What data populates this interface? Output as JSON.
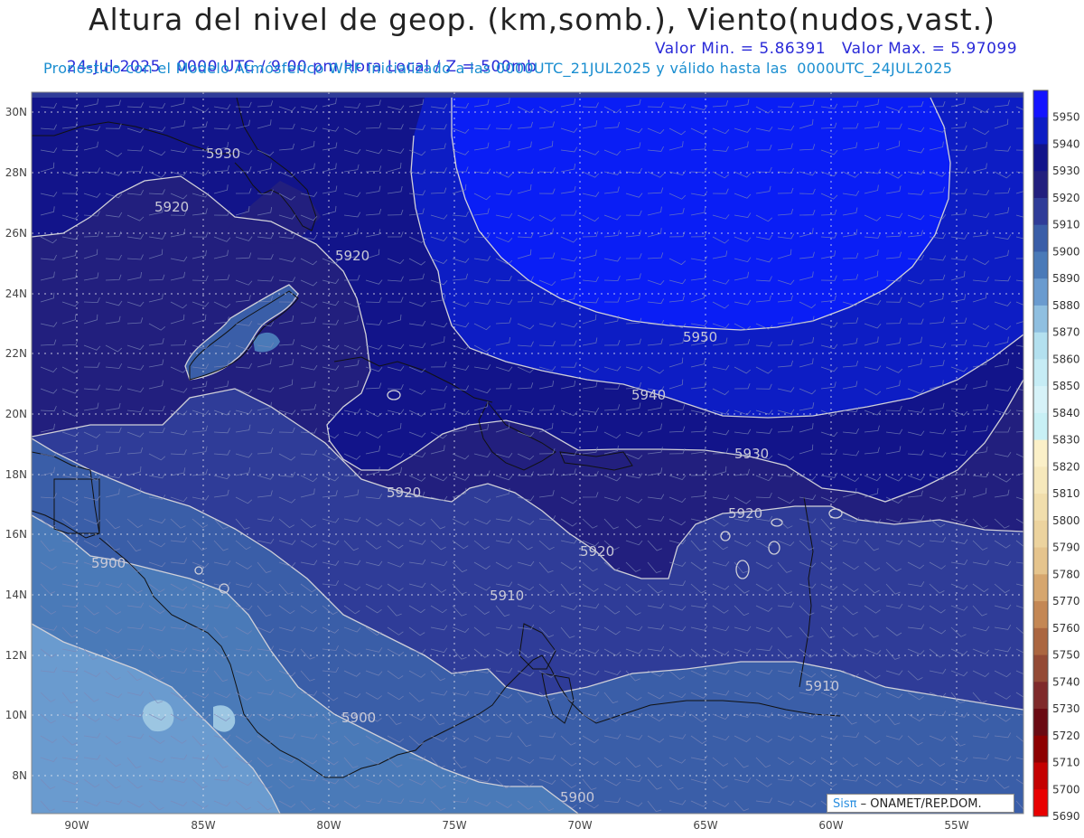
{
  "header": {
    "title": "Altura del nivel de geop. (km,somb.), Viento(nudos,vast.)",
    "subtitle_left": "24-Jul-2025   0000 UTC / 9:00 pm Hora Local / Z = 500mb",
    "subtitle_right": "Valor Min. = 5.86391   Valor Max. = 5.97099",
    "subtitle2": "Pronóstico con el Modelo Atmósferico WRF inicializado a las 0000UTC_21JUL2025 y válido hasta las  0000UTC_24JUL2025"
  },
  "map": {
    "lat_labels": [
      "30N",
      "28N",
      "26N",
      "24N",
      "22N",
      "20N",
      "18N",
      "16N",
      "14N",
      "12N",
      "10N",
      "8N"
    ],
    "lon_labels": [
      "90W",
      "85W",
      "80W",
      "75W",
      "70W",
      "65W",
      "60W",
      "55W"
    ],
    "contour_labels": [
      "5930",
      "5920",
      "5920",
      "5950",
      "5940",
      "5930",
      "5920",
      "5920",
      "5920",
      "5910",
      "5900",
      "5910",
      "5900",
      "5900"
    ],
    "colors": {
      "5950": "#0a1ef5",
      "5940": "#0d1dc4",
      "5930": "#12148a",
      "5920": "#221f7e",
      "5910": "#2f3c98",
      "5900": "#3a5ea8",
      "5890": "#4a7ab8",
      "5880": "#6a9bcf",
      "5870": "#9cc6e2",
      "contour_line": "#d0d0d8",
      "coast": "#111111"
    }
  },
  "colorbar": {
    "labels": [
      "5950",
      "5940",
      "5930",
      "5920",
      "5910",
      "5900",
      "5890",
      "5880",
      "5870",
      "5860",
      "5850",
      "5840",
      "5830",
      "5820",
      "5810",
      "5800",
      "5790",
      "5780",
      "5770",
      "5760",
      "5750",
      "5740",
      "5730",
      "5720",
      "5710",
      "5700",
      "5690"
    ],
    "colors": [
      "#1414ff",
      "#0d1dc4",
      "#12148a",
      "#221f7e",
      "#2f3c98",
      "#3a5ea8",
      "#4a7ab8",
      "#6a9bcf",
      "#8fbfe0",
      "#b3e0ef",
      "#c6ecf5",
      "#d6f2f8",
      "#c8f0f5",
      "#fbf0c8",
      "#f6e8bb",
      "#f1deac",
      "#ecd39e",
      "#e5c48d",
      "#d6a66e",
      "#c48754",
      "#ab6640",
      "#944a35",
      "#7f2a2a",
      "#6a0a12",
      "#8d0000",
      "#c40000",
      "#e80000"
    ]
  },
  "credit": {
    "brand": "Sisπ",
    "text": "– ONAMET/REP.DOM."
  }
}
